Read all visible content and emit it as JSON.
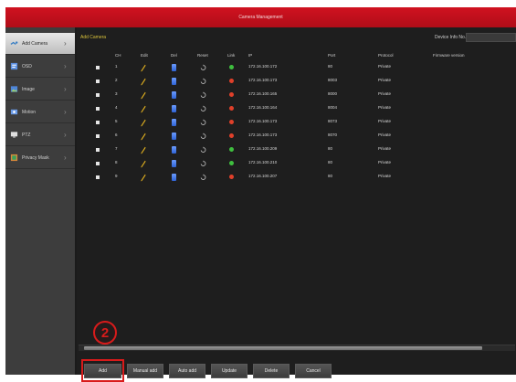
{
  "window": {
    "title": "Camera Management"
  },
  "sidebar": {
    "items": [
      {
        "label": "Add Camera",
        "icon": "camera-add-icon",
        "active": true
      },
      {
        "label": "OSD",
        "icon": "osd-icon",
        "active": false
      },
      {
        "label": "Image",
        "icon": "image-icon",
        "active": false
      },
      {
        "label": "Motion",
        "icon": "motion-icon",
        "active": false
      },
      {
        "label": "PTZ",
        "icon": "ptz-icon",
        "active": false
      },
      {
        "label": "Privacy Mask",
        "icon": "privacy-mask-icon",
        "active": false
      }
    ]
  },
  "toolbar": {
    "tab_label": "Add Camera",
    "search_label": "Device Info No."
  },
  "table": {
    "headers": [
      "",
      "CH",
      "Edit",
      "Del",
      "Reset",
      "Link",
      "IP",
      "Port",
      "Protocol",
      "Firmware version"
    ],
    "rows": [
      {
        "ch": "1",
        "ip": "172.16.100.172",
        "port": "80",
        "protocol": "Private",
        "status": "online"
      },
      {
        "ch": "2",
        "ip": "172.16.100.173",
        "port": "8003",
        "protocol": "Private",
        "status": "offline"
      },
      {
        "ch": "3",
        "ip": "172.16.100.165",
        "port": "8000",
        "protocol": "Private",
        "status": "offline"
      },
      {
        "ch": "4",
        "ip": "172.16.100.164",
        "port": "8004",
        "protocol": "Private",
        "status": "offline"
      },
      {
        "ch": "5",
        "ip": "172.16.100.173",
        "port": "8073",
        "protocol": "Private",
        "status": "offline"
      },
      {
        "ch": "6",
        "ip": "172.16.100.173",
        "port": "8070",
        "protocol": "Private",
        "status": "offline"
      },
      {
        "ch": "7",
        "ip": "172.16.100.209",
        "port": "80",
        "protocol": "Private",
        "status": "online"
      },
      {
        "ch": "8",
        "ip": "172.16.100.210",
        "port": "80",
        "protocol": "Private",
        "status": "online"
      },
      {
        "ch": "9",
        "ip": "172.16.100.207",
        "port": "80",
        "protocol": "Private",
        "status": "offline"
      }
    ]
  },
  "buttons": {
    "add": "Add",
    "manual_add": "Manual add",
    "auto_add": "Auto add",
    "update": "Update",
    "delete": "Delete",
    "cancel": "Cancel"
  },
  "annotation": {
    "step": "2"
  },
  "colors": {
    "title_red": "#c41020",
    "online": "#3fbf3f",
    "offline": "#e0402a",
    "edit_pencil": "#e3b21f",
    "delete_blue": "#3f74e8",
    "annotation_red": "#d81b1b"
  }
}
